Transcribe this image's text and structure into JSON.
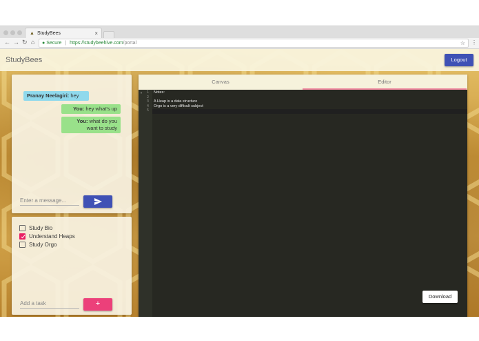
{
  "browser": {
    "tab_title": "StudyBees",
    "tab_close": "×",
    "secure_label": "Secure",
    "url_scheme_host": "https://studybeehive.com",
    "url_path": "/portal"
  },
  "app": {
    "brand": "StudyBees",
    "logout_label": "Logout",
    "accent_color": "#3f51b5",
    "add_color": "#e91e63"
  },
  "chat": {
    "messages": [
      {
        "sender": "Pranay Neelagiri:",
        "text": " hey"
      },
      {
        "sender": "You:",
        "text": " hey what's up"
      },
      {
        "sender": "You:",
        "text": " what do you want to study"
      }
    ],
    "input_placeholder": "Enter a message...",
    "send_icon": "send-icon"
  },
  "todo": {
    "items": [
      {
        "label": "Study Bio",
        "checked": false
      },
      {
        "label": "Understand Heaps",
        "checked": true
      },
      {
        "label": "Study Orgo",
        "checked": false
      }
    ],
    "input_placeholder": "Add a task",
    "add_label": "+"
  },
  "workspace": {
    "tabs": [
      {
        "label": "Canvas",
        "active": false
      },
      {
        "label": "Editor",
        "active": true
      }
    ],
    "line_numbers": [
      "1",
      "2",
      "3",
      "4",
      "5"
    ],
    "lines": [
      "Notes:",
      "",
      "A Heap is a data structure",
      "Orgo is a very difficult subject",
      ""
    ],
    "download_label": "Download"
  }
}
